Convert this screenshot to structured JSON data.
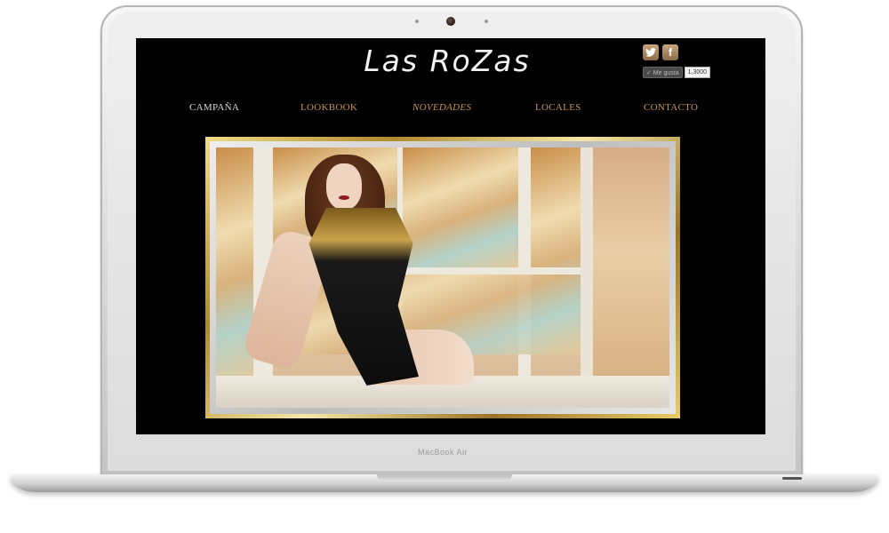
{
  "site": {
    "logo_text": "Las RoZas"
  },
  "social": {
    "twitter_icon": "twitter-icon",
    "facebook_icon": "facebook-icon",
    "facebook_glyph": "f",
    "like_label": "✓ Me gusta",
    "like_count": "1,3000"
  },
  "nav": {
    "items": [
      {
        "label": "CAMPAÑA",
        "state": "active"
      },
      {
        "label": "LOOKBOOK",
        "state": "normal"
      },
      {
        "label": "NOVEDADES",
        "state": "italic"
      },
      {
        "label": "LOCALES",
        "state": "normal"
      },
      {
        "label": "CONTACTO",
        "state": "normal"
      }
    ]
  },
  "hero": {
    "image": "campaign-photo",
    "subject": "model-in-black-sequin-dress"
  },
  "device": {
    "hinge_label": "MacBook Air"
  },
  "colors": {
    "background": "#000000",
    "nav_text": "#c9944e",
    "nav_active": "#d9d9d9",
    "frame_gold": "#c9a24a",
    "logo": "#f2f2f2"
  }
}
